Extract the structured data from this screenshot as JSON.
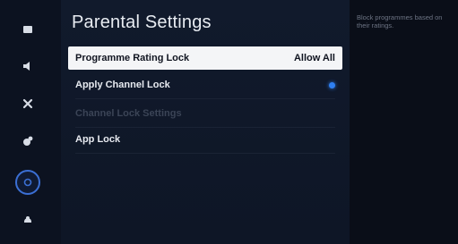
{
  "sidebar": {
    "items": [
      {
        "name": "picture-icon"
      },
      {
        "name": "sound-icon"
      },
      {
        "name": "network-icon"
      },
      {
        "name": "system-icon"
      },
      {
        "name": "parental-settings-icon",
        "active": true
      },
      {
        "name": "support-icon"
      }
    ]
  },
  "main": {
    "title": "Parental Settings",
    "rows": [
      {
        "label": "Programme Rating Lock",
        "value": "Allow All",
        "state": "selected"
      },
      {
        "label": "Apply Channel Lock",
        "value": "",
        "state": "normal",
        "toggle": true
      },
      {
        "label": "Channel Lock Settings",
        "value": "",
        "state": "disabled"
      },
      {
        "label": "App Lock",
        "value": "",
        "state": "normal"
      }
    ]
  },
  "help": {
    "text": "Block programmes based on their ratings."
  },
  "colors": {
    "accent": "#2f7ff0",
    "selected_bg": "#f4f5f7"
  }
}
